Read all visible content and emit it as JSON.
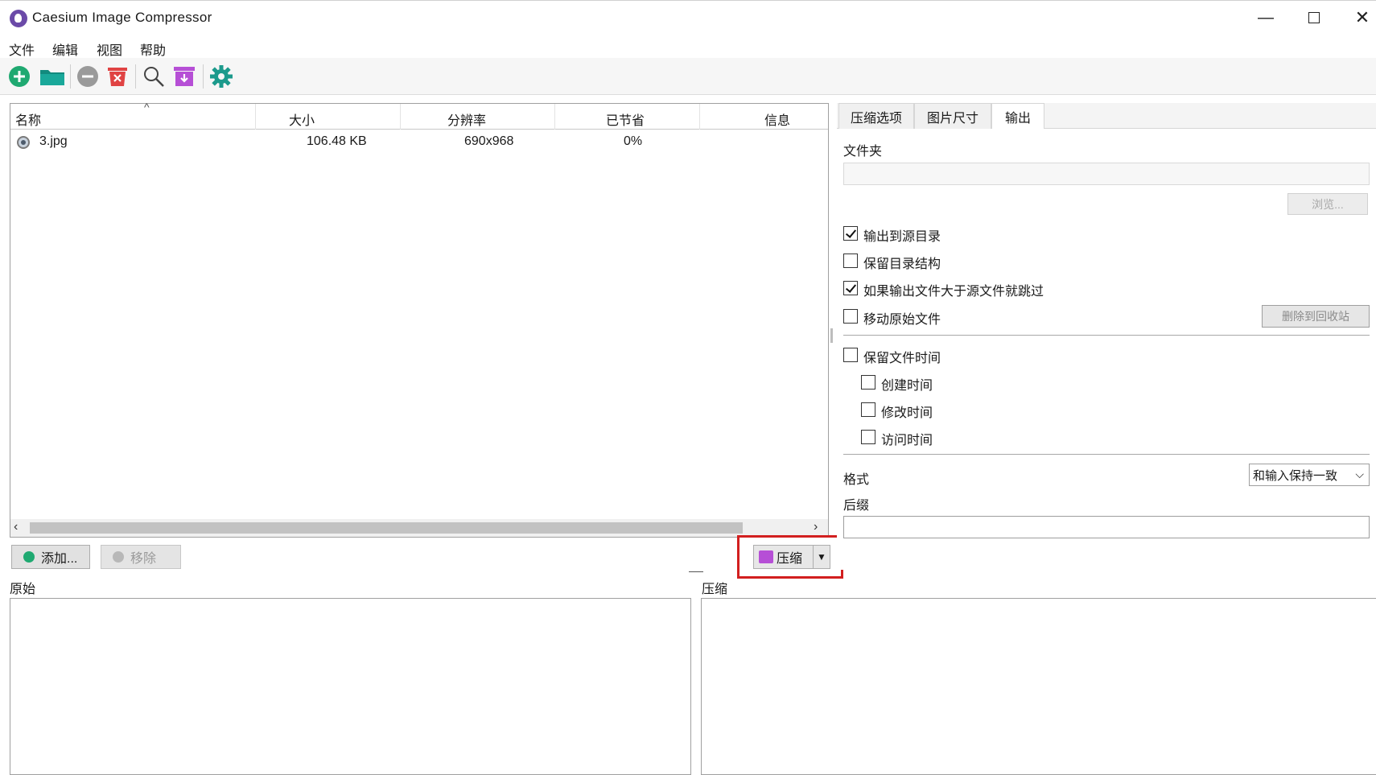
{
  "window": {
    "title": "Caesium Image Compressor"
  },
  "menu": [
    "文件",
    "编辑",
    "视图",
    "帮助"
  ],
  "toolbar": {
    "icons": [
      "add-icon",
      "open-folder-icon",
      "remove-icon",
      "clear-list-icon",
      "preview-icon",
      "compress-archive-icon",
      "settings-icon"
    ],
    "colors": {
      "green": "#1fa971",
      "folder": "#1aa89a",
      "gray": "#9a9a9a",
      "red": "#e04343",
      "purple": "#b64fd6",
      "settings": "#1c9a8c"
    }
  },
  "file_list": {
    "columns": [
      "名称",
      "大小",
      "分辨率",
      "已节省",
      "信息"
    ],
    "rows": [
      {
        "name": "3.jpg",
        "size": "106.48 KB",
        "resolution": "690x968",
        "saved": "0%",
        "info": ""
      }
    ]
  },
  "buttons": {
    "add": "添加...",
    "remove": "移除",
    "compress": "压缩"
  },
  "preview": {
    "original_label": "原始",
    "compressed_label": "压缩"
  },
  "tabs": [
    "压缩选项",
    "图片尺寸",
    "输出"
  ],
  "output": {
    "folder_label": "文件夹",
    "folder_value": "",
    "browse": "浏览...",
    "options": [
      {
        "label": "输出到源目录",
        "checked": true
      },
      {
        "label": "保留目录结构",
        "checked": false
      },
      {
        "label": "如果输出文件大于源文件就跳过",
        "checked": true
      },
      {
        "label": "移动原始文件",
        "checked": false
      }
    ],
    "move_target_button": "删除到回收站",
    "keep_time": {
      "label": "保留文件时间",
      "checked": false
    },
    "time_options": [
      {
        "label": "创建时间",
        "checked": false
      },
      {
        "label": "修改时间",
        "checked": false
      },
      {
        "label": "访问时间",
        "checked": false
      }
    ],
    "format_label": "格式",
    "format_value": "和输入保持一致",
    "suffix_label": "后缀",
    "suffix_value": ""
  }
}
